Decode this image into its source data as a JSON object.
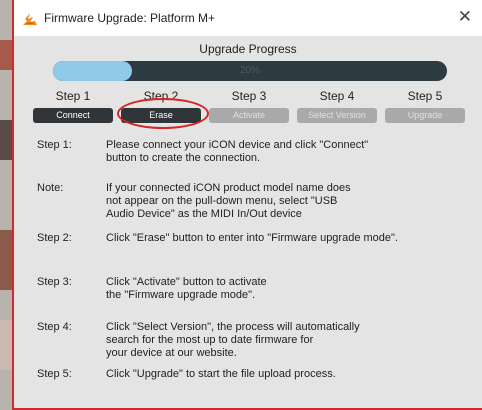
{
  "window": {
    "title": "Firmware Upgrade: Platform M+",
    "close_symbol": "✕"
  },
  "progress": {
    "title": "Upgrade Progress",
    "percent_text": "20%",
    "fraction": 0.2
  },
  "steps": [
    {
      "label": "Step 1",
      "button": "Connect",
      "state": "active"
    },
    {
      "label": "Step 2",
      "button": "Erase",
      "state": "active"
    },
    {
      "label": "Step 3",
      "button": "Activate",
      "state": "disabled"
    },
    {
      "label": "Step 4",
      "button": "Select Version",
      "state": "disabled"
    },
    {
      "label": "Step 5",
      "button": "Upgrade",
      "state": "disabled"
    }
  ],
  "instructions": [
    {
      "label": "Step 1:",
      "text": "Please connect your iCON device and click \"Connect\"\nbutton to create the connection."
    },
    {
      "label": "Note:",
      "text": "If your connected iCON product model name does\nnot appear on the pull-down menu, select \"USB\nAudio Device\" as the MIDI In/Out device"
    },
    {
      "label": "Step 2:",
      "text": "Click \"Erase\" button to enter into \"Firmware upgrade mode\"."
    },
    {
      "label": "Step 3:",
      "text": "Click \"Activate\" button to activate\nthe \"Firmware upgrade mode\"."
    },
    {
      "label": "Step 4:",
      "text": "Click \"Select Version\", the process will automatically\nsearch for the most up to date firmware for\nyour device at our website."
    },
    {
      "label": "Step 5:",
      "text": "Click \"Upgrade\" to start the file upload process."
    }
  ],
  "colors": {
    "highlight": "#d62424",
    "progress_fill": "#8fcbe8",
    "progress_track": "#2e3a42",
    "button_active": "#2f3539",
    "button_disabled": "#a9a9a9"
  }
}
